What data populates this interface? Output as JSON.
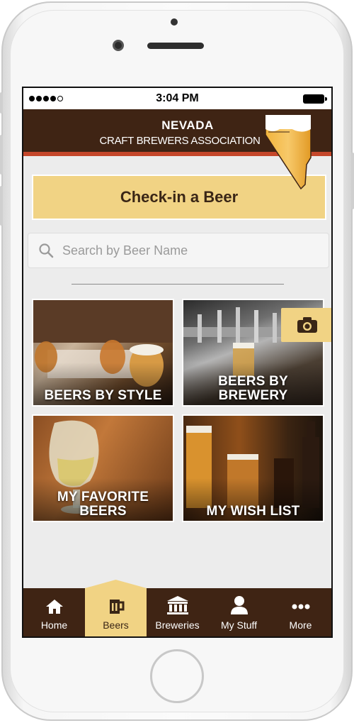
{
  "status_bar": {
    "time": "3:04 PM"
  },
  "header": {
    "title_line1": "NEVADA",
    "title_line2": "CRAFT BREWERS ASSOCIATION",
    "logo_icon": "nevada-state-beer-logo"
  },
  "checkin": {
    "label": "Check-in a Beer"
  },
  "search": {
    "placeholder": "Search by Beer Name",
    "value": ""
  },
  "tiles": [
    {
      "label": "BEERS BY STYLE"
    },
    {
      "label_line1": "BEERS BY",
      "label_line2": "BREWERY"
    },
    {
      "label_line1": "MY FAVORITE",
      "label_line2": "BEERS"
    },
    {
      "label": "MY WISH LIST"
    }
  ],
  "camera": {
    "icon": "camera-icon"
  },
  "tab_bar": {
    "items": [
      {
        "label": "Home",
        "icon": "home-icon"
      },
      {
        "label": "Beers",
        "icon": "beer-mug-icon",
        "active": true
      },
      {
        "label": "Breweries",
        "icon": "building-icon"
      },
      {
        "label": "My Stuff",
        "icon": "user-icon"
      },
      {
        "label": "More",
        "icon": "more-icon"
      }
    ]
  },
  "colors": {
    "brand_brown": "#3f2414",
    "accent_gold": "#f1d384",
    "accent_red": "#c5472a"
  }
}
